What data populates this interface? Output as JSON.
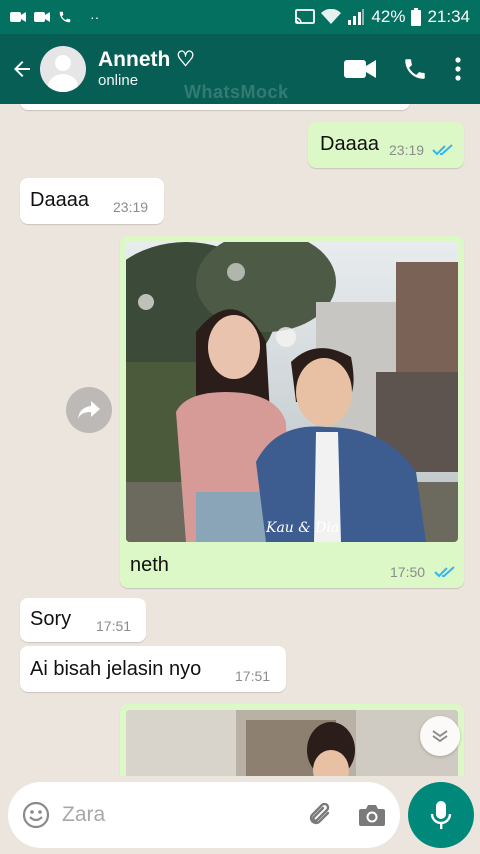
{
  "status_bar": {
    "battery": "42%",
    "time": "21:34"
  },
  "header": {
    "name": "Anneth ♡",
    "status": "online",
    "watermark": "WhatsMock"
  },
  "messages": [
    {
      "dir": "out",
      "text": "Daaaa",
      "time": "23:19",
      "read": true
    },
    {
      "dir": "in",
      "text": "Daaaa",
      "time": "23:19"
    },
    {
      "dir": "out",
      "type": "image",
      "caption": "neth",
      "time": "17:50",
      "read": true,
      "image_signature": "Kau & Dia"
    },
    {
      "dir": "in",
      "text": "Sory",
      "time": "17:51"
    },
    {
      "dir": "in",
      "text": "Ai bisah jelasin nyo",
      "time": "17:51"
    },
    {
      "dir": "out",
      "type": "image"
    }
  ],
  "input": {
    "placeholder": "Zara"
  },
  "icons": [
    "back-arrow-icon",
    "video-call-icon",
    "phone-icon",
    "more-vert-icon",
    "forward-icon",
    "chevron-down-icon",
    "emoji-icon",
    "attach-icon",
    "camera-icon",
    "mic-icon"
  ],
  "colors": {
    "header": "#075e54",
    "status_bar": "#04705f",
    "outgoing_bubble": "#dcf8c6",
    "incoming_bubble": "#ffffff",
    "chat_bg": "#ece5dd",
    "read_ticks": "#34b7f1",
    "mic_button": "#00897b"
  }
}
